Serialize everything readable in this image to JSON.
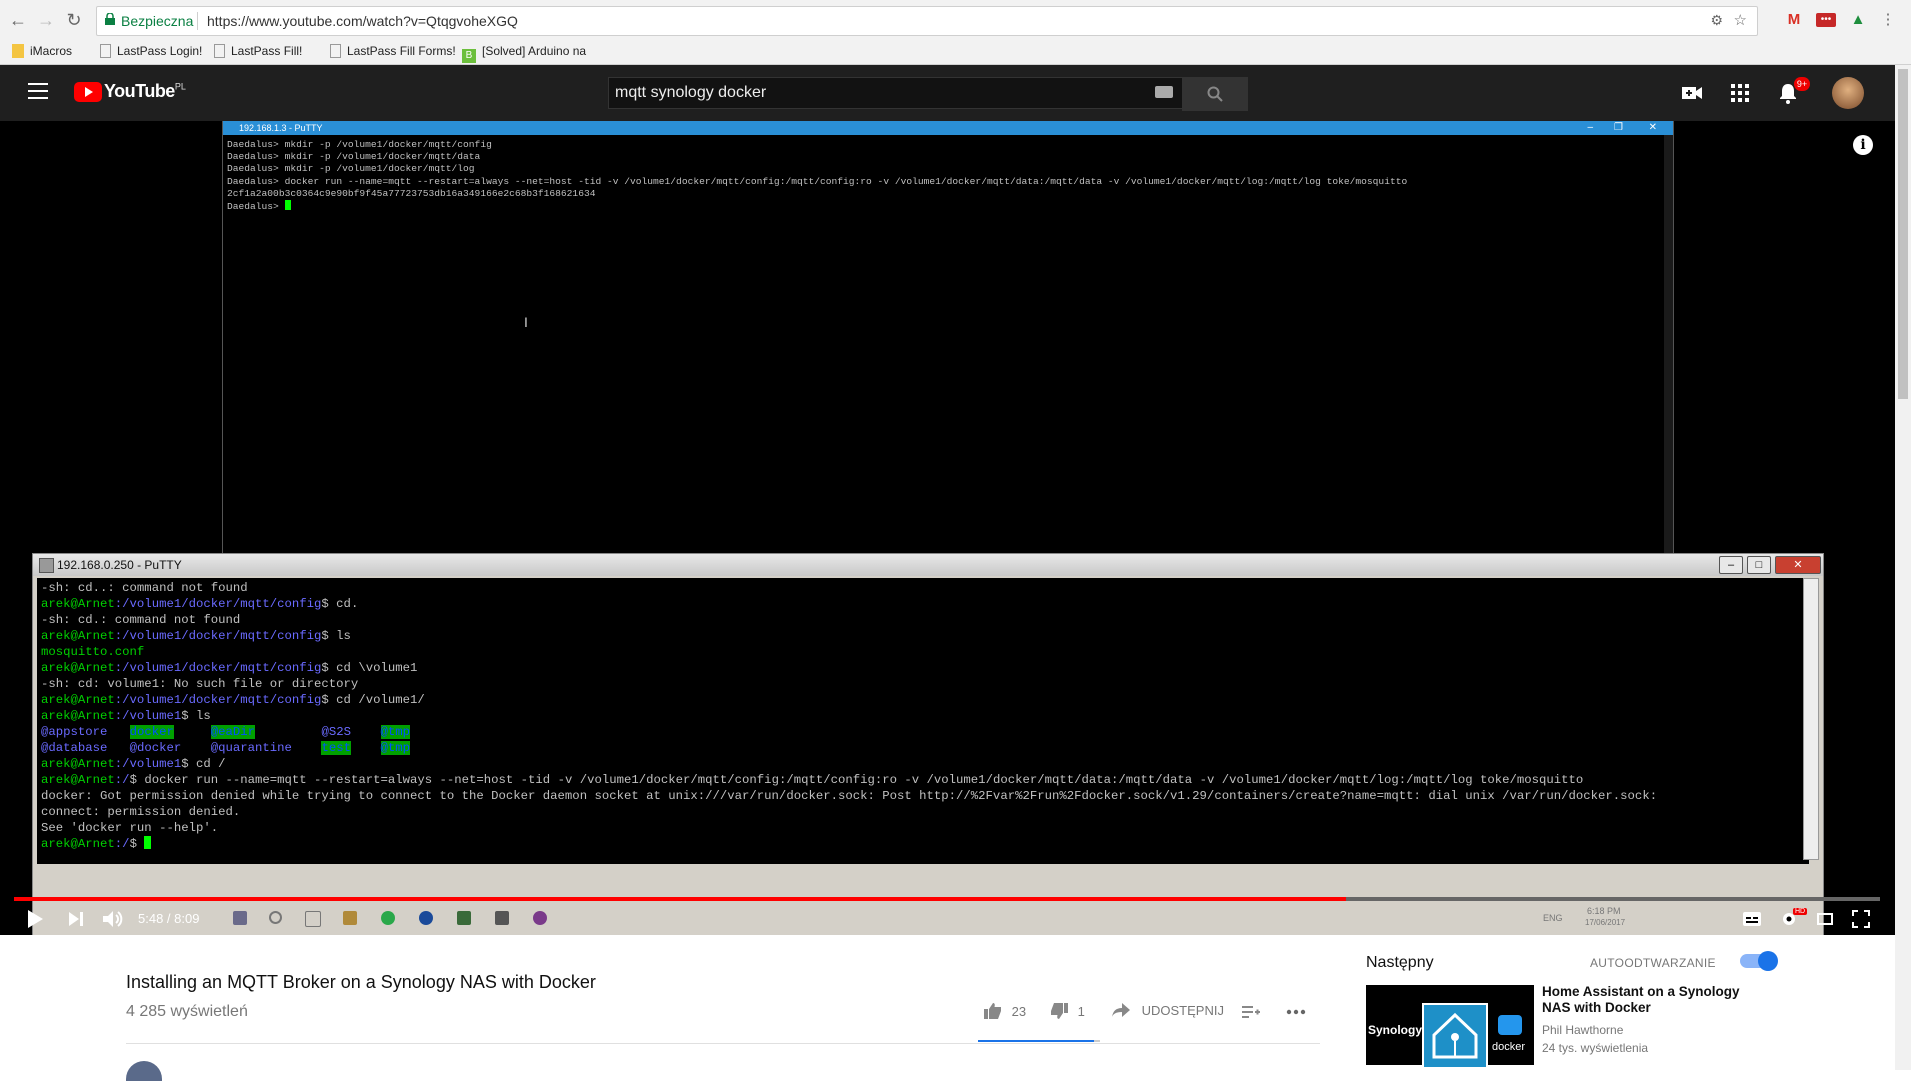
{
  "browser": {
    "secure_label": "Bezpieczna",
    "url": "https://www.youtube.com/watch?v=QtqgvoheXGQ",
    "bookmarks": [
      "iMacros",
      "LastPass Login!",
      "LastPass Fill!",
      "LastPass Fill Forms!",
      "[Solved] Arduino na"
    ]
  },
  "youtube": {
    "logo_text": "YouTube",
    "logo_region": "PL",
    "search_query": "mqtt synology docker",
    "notification_count": "9+"
  },
  "putty_back": {
    "title": "192.168.1.3 - PuTTY",
    "lines": [
      "Daedalus> mkdir -p /volume1/docker/mqtt/config",
      "Daedalus> mkdir -p /volume1/docker/mqtt/data",
      "Daedalus> mkdir -p /volume1/docker/mqtt/log",
      "Daedalus> docker run --name=mqtt --restart=always --net=host -tid -v /volume1/docker/mqtt/config:/mqtt/config:ro -v /volume1/docker/mqtt/data:/mqtt/data -v /volume1/docker/mqtt/log:/mqtt/log toke/mosquitto",
      "2cf1a2a00b3c0364c9e90bf9f45a77723753db16a349166e2c68b3f168621634"
    ],
    "prompt": "Daedalus> "
  },
  "putty_front": {
    "title": "192.168.0.250 - PuTTY",
    "lines": [
      {
        "t": "-sh: cd..: command not found"
      },
      {
        "u": "arek@Arnet",
        "p": ":/volume1/docker/mqtt/config",
        "c": "$ cd."
      },
      {
        "t": "-sh: cd.: command not found"
      },
      {
        "u": "arek@Arnet",
        "p": ":/volume1/docker/mqtt/config",
        "c": "$ ls"
      },
      {
        "g": "mosquitto.conf"
      },
      {
        "u": "arek@Arnet",
        "p": ":/volume1/docker/mqtt/config",
        "c": "$ cd \\volume1"
      },
      {
        "t": "-sh: cd: volume1: No such file or directory"
      },
      {
        "u": "arek@Arnet",
        "p": ":/volume1/docker/mqtt/config",
        "c": "$ cd /volume1/"
      },
      {
        "u": "arek@Arnet",
        "p": ":/volume1",
        "c": "$ ls"
      },
      {
        "ls1": true
      },
      {
        "ls2": true
      },
      {
        "u": "arek@Arnet",
        "p": ":/volume1",
        "c": "$ cd /"
      },
      {
        "u": "arek@Arnet",
        "p": ":/",
        "c": "$ docker run --name=mqtt --restart=always --net=host -tid -v /volume1/docker/mqtt/config:/mqtt/config:ro -v /volume1/docker/mqtt/data:/mqtt/data -v /volume1/docker/mqtt/log:/mqtt/log toke/mosquitto"
      },
      {
        "t": "docker: Got permission denied while trying to connect to the Docker daemon socket at unix:///var/run/docker.sock: Post http://%2Fvar%2Frun%2Fdocker.sock/v1.29/containers/create?name=mqtt: dial unix /var/run/docker.sock:"
      },
      {
        "t": "connect: permission denied."
      },
      {
        "t": "See 'docker run --help'."
      }
    ],
    "ls_row1": [
      "@appstore",
      "docker",
      "@eaDir",
      "@S2S",
      "@tmp"
    ],
    "ls_row2": [
      "@database",
      "@docker",
      "@quarantine",
      "test",
      "@tmp"
    ],
    "final_prompt_user": "arek@Arnet",
    "final_prompt_path": ":/",
    "final_prompt_tail": "$ "
  },
  "player": {
    "time": "5:48 / 8:09",
    "progress_fraction": 0.714,
    "taskbar_tray": {
      "lang": "ENG",
      "time": "6:18 PM",
      "date": "17/06/2017"
    }
  },
  "video": {
    "title": "Installing an MQTT Broker on a Synology NAS with Docker",
    "views": "4 285 wyświetleń",
    "likes": "23",
    "dislikes": "1",
    "share_label": "UDOSTĘPNIJ"
  },
  "sidebar": {
    "next_label": "Następny",
    "autoplay_label": "AUTOODTWARZANIE",
    "next_video": {
      "title": "Home Assistant on a Synology NAS with Docker",
      "channel": "Phil Hawthorne",
      "views": "24 tys. wyświetlenia",
      "thumb_text_left": "Synology",
      "thumb_text_right": "docker"
    }
  },
  "colors": {
    "yt_red": "#ff0000",
    "term_green": "#00d000",
    "term_blue": "#6a6aff",
    "link_blue": "#1a73e8"
  }
}
